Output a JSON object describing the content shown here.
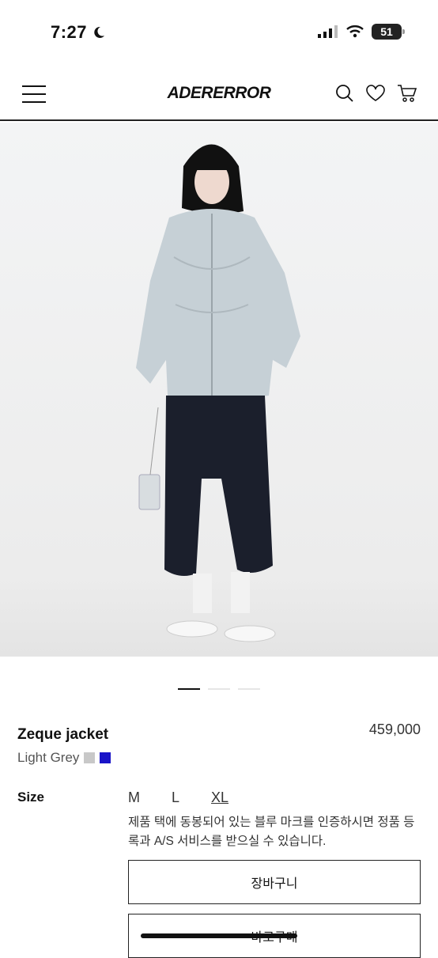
{
  "status_bar": {
    "time": "7:27",
    "battery": "51"
  },
  "header": {
    "logo": "ADERERROR"
  },
  "carousel": {
    "slide_count": 3,
    "active_index": 0
  },
  "product": {
    "name": "Zeque jacket",
    "price": "459,000",
    "color_name": "Light Grey",
    "swatches": [
      "#c8c8c8",
      "#1a14c8"
    ],
    "size_label": "Size",
    "sizes": [
      "M",
      "L",
      "XL"
    ],
    "selected_size": "XL",
    "notice": "제품 택에 동봉되어 있는 블루 마크를 인증하시면 정품 등록과 A/S 서비스를 받으실 수 있습니다."
  },
  "actions": {
    "cart": "장바구니",
    "buy_now": "바로구매"
  }
}
